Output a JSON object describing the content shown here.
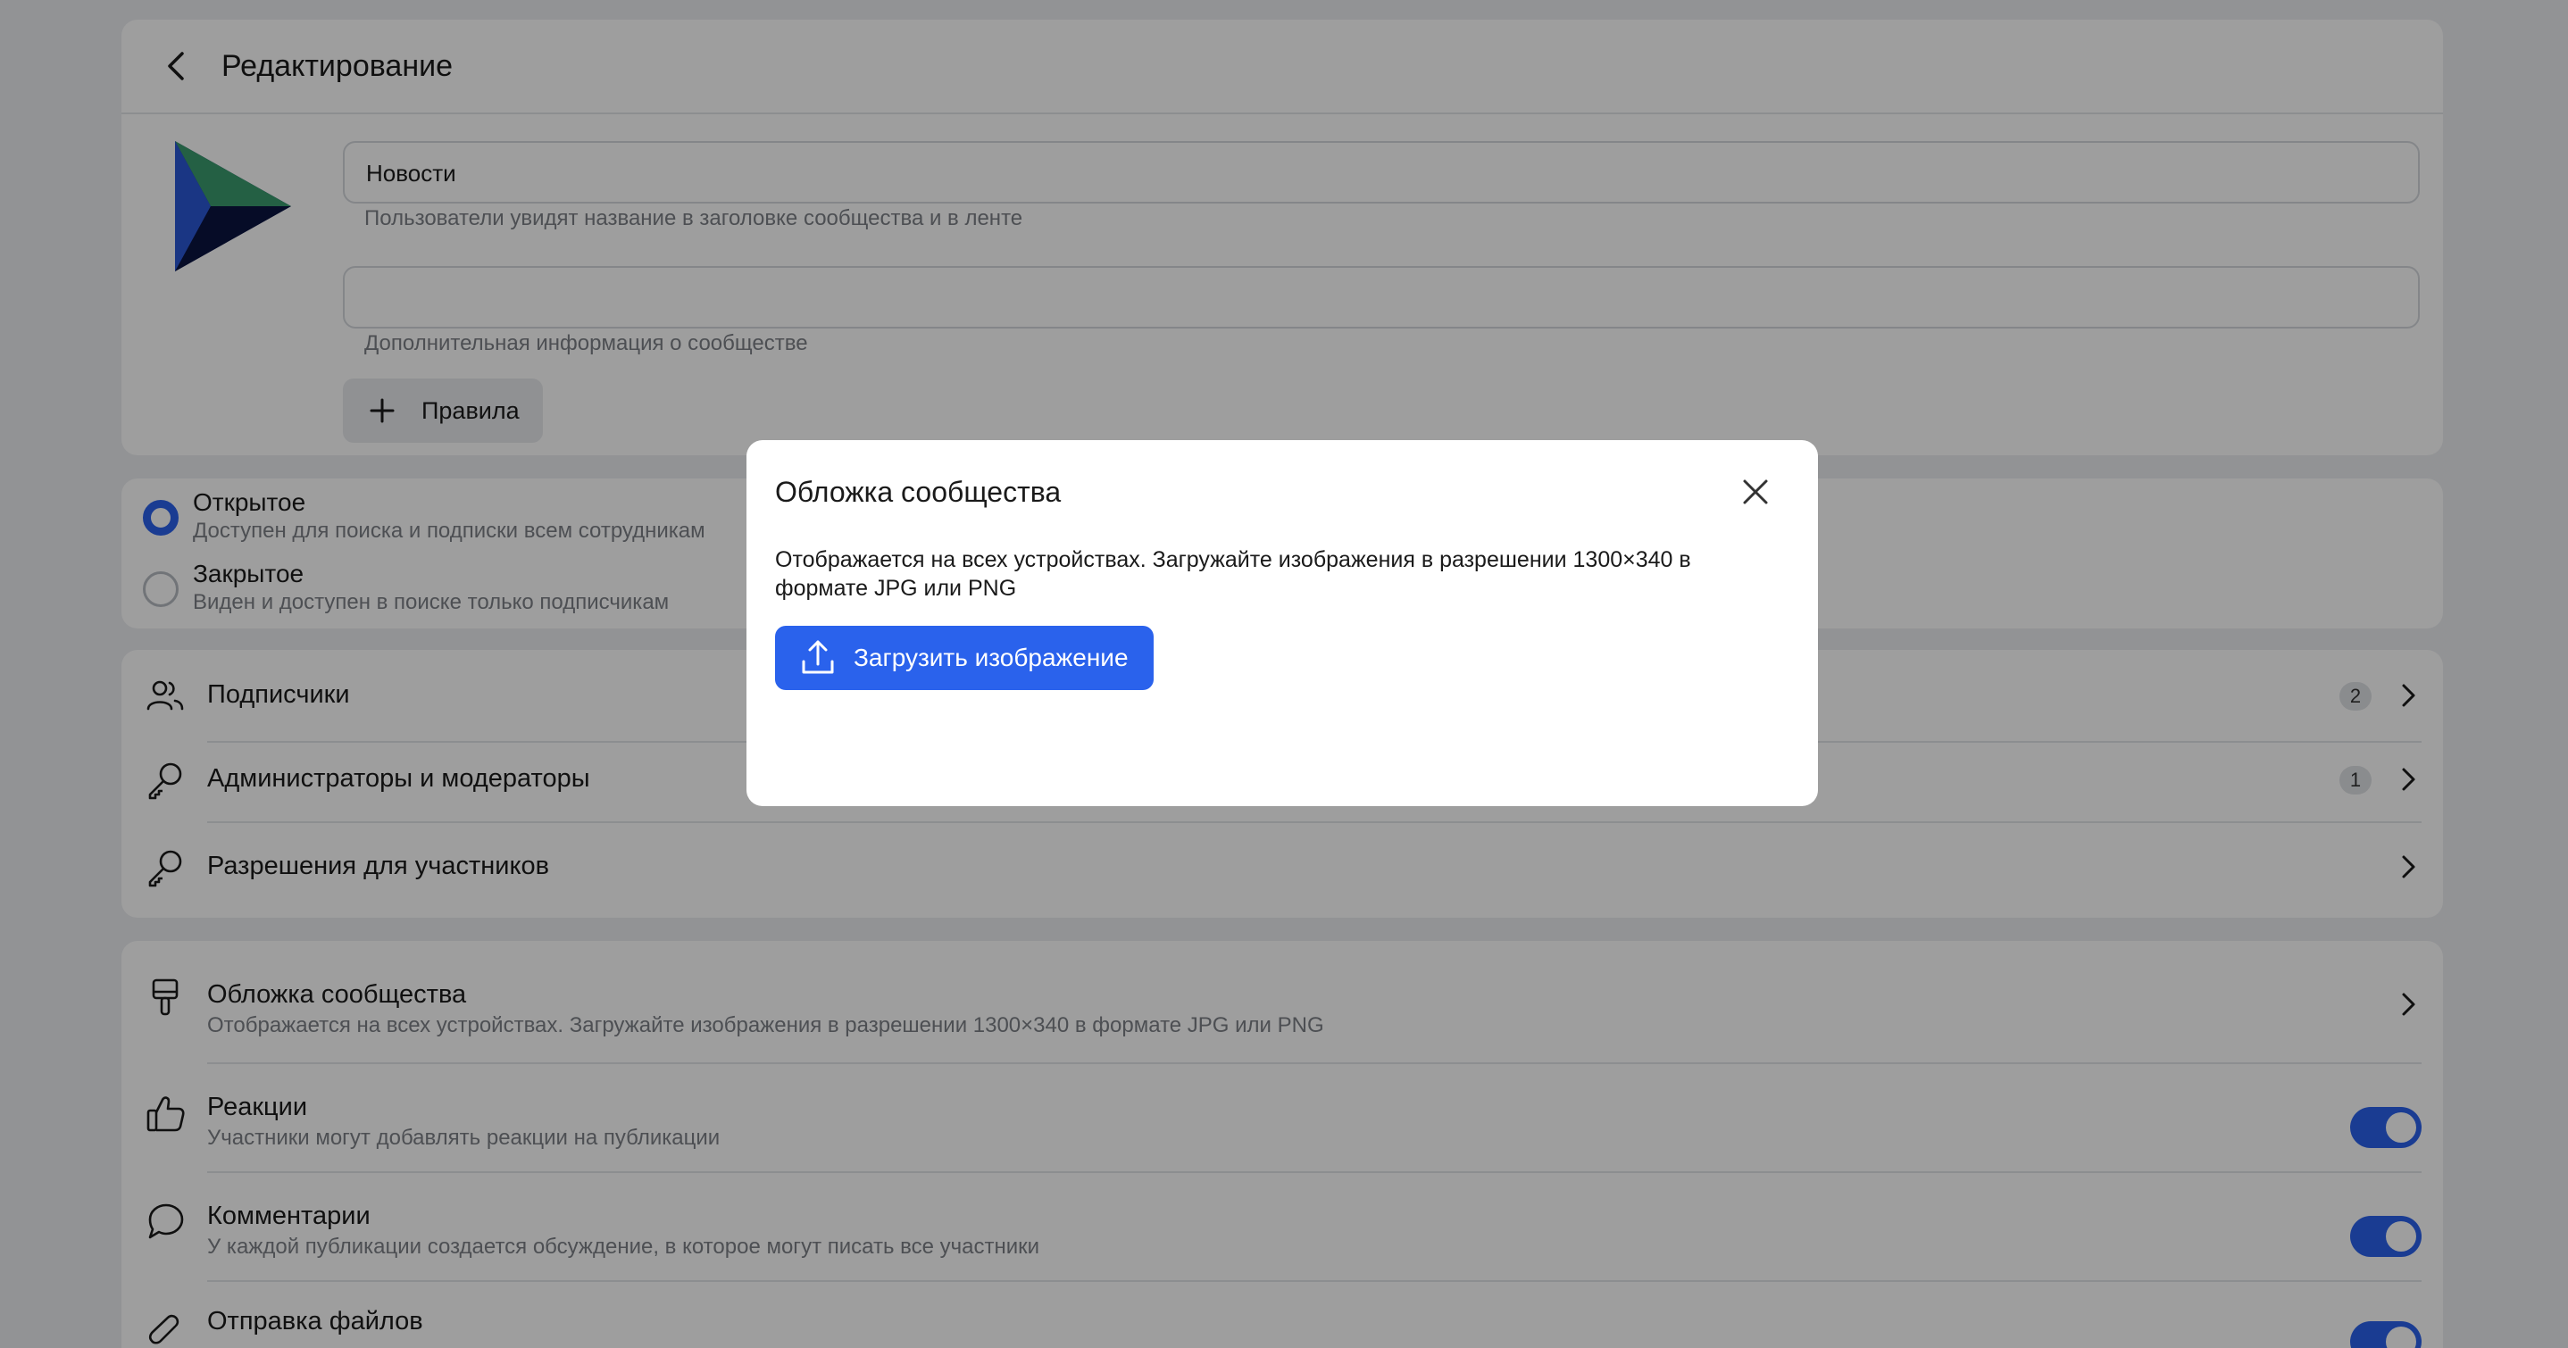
{
  "header": {
    "title": "Редактирование"
  },
  "community": {
    "name_value": "Новости",
    "name_hint": "Пользователи увидят название в заголовке сообщества и в ленте",
    "description_value": "",
    "description_hint": "Дополнительная информация о сообществе",
    "rules_button_label": "Правила"
  },
  "access": {
    "open_title": "Открытое",
    "open_subtitle": "Доступен для поиска и подписки всем сотрудникам",
    "closed_title": "Закрытое",
    "closed_subtitle": "Виден и доступен в поиске только подписчикам",
    "selected": "open"
  },
  "members": {
    "items": [
      {
        "label": "Подписчики",
        "count": "2",
        "icon": "users-icon"
      },
      {
        "label": "Администраторы и модераторы",
        "count": "1",
        "icon": "key-icon"
      },
      {
        "label": "Разрешения для участников",
        "count": "",
        "icon": "key-icon"
      }
    ]
  },
  "settings": {
    "items": [
      {
        "title": "Обложка сообщества",
        "subtitle": "Отображается на всех устройствах. Загружайте изображения в разрешении 1300×340 в формате JPG или PNG",
        "icon": "brush-icon",
        "control": "chevron"
      },
      {
        "title": "Реакции",
        "subtitle": "Участники могут добавлять реакции на публикации",
        "icon": "thumbs-up-icon",
        "control": "toggle",
        "on": true
      },
      {
        "title": "Комментарии",
        "subtitle": "У каждой публикации создается обсуждение, в которое могут писать все участники",
        "icon": "chat-bubble-icon",
        "control": "toggle",
        "on": true
      },
      {
        "title": "Отправка файлов",
        "subtitle": "",
        "icon": "paperclip-icon",
        "control": "toggle",
        "on": true
      }
    ]
  },
  "modal": {
    "title": "Обложка сообщества",
    "description": "Отображается на всех устройствах. Загружайте изображения в разрешении 1300×340 в формате JPG или PNG",
    "upload_label": "Загрузить изображение"
  },
  "colors": {
    "accent": "#2a62ec",
    "overlay": "rgba(0,0,0,0.38)"
  }
}
